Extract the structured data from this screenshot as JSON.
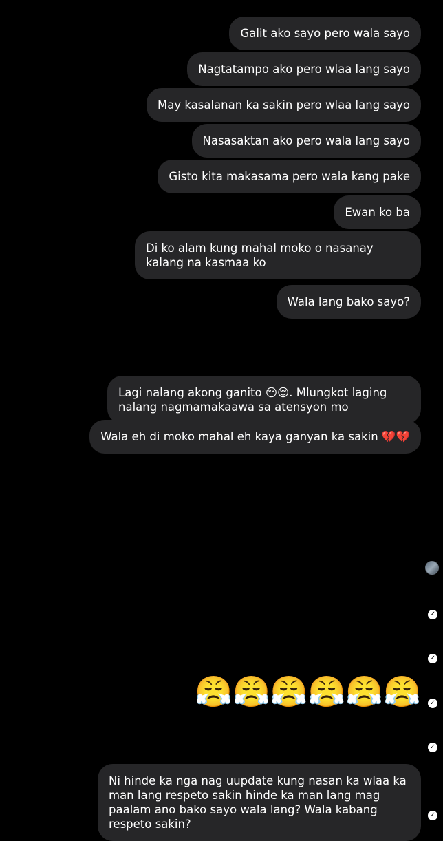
{
  "messages": {
    "m1": "Galit ako sayo pero wala sayo",
    "m2": "Nagtatampo ako pero wlaa lang sayo",
    "m3": "May kasalanan ka sakin pero wlaa lang sayo",
    "m4": "Nasasaktan ako pero wala lang sayo",
    "m5": "Gisto kita makasama pero wala kang pake",
    "m6": "Ewan ko ba",
    "m7": "Di ko alam kung mahal moko o nasanay kalang na kasmaa ko",
    "m8": "Wala lang bako sayo?",
    "e1": "😔😔😔",
    "m9": "Lagi nalang akong ganito 😔😌. Mlungkot laging nalang nagmamakaawa sa atensyon mo",
    "m10": "Wala eh di moko mahal eh kaya ganyan ka sakin 💔💔",
    "e2": "😭😭😭😭",
    "e3": "😭😭😭😭😭😭😭😭😿😿😿😿😿",
    "e4": "😔😔😔😔😞😞",
    "e5": "😭😭😭😭😭😭",
    "e6": "😤😤😤😤😤😤",
    "e7": "😥😥",
    "m11": "Ni hinde ka nga nag uupdate kung nasan ka wlaa ka man lang respeto sakin hinde ka man lang mag paalam ano bako sayo wala lang? Wala kabang respeto sakin?"
  },
  "icons": {
    "seen": "check-circle-icon",
    "avatar": "contact-avatar"
  },
  "colors": {
    "background": "#000000",
    "bubble": "#262628",
    "text": "#ffffff"
  }
}
